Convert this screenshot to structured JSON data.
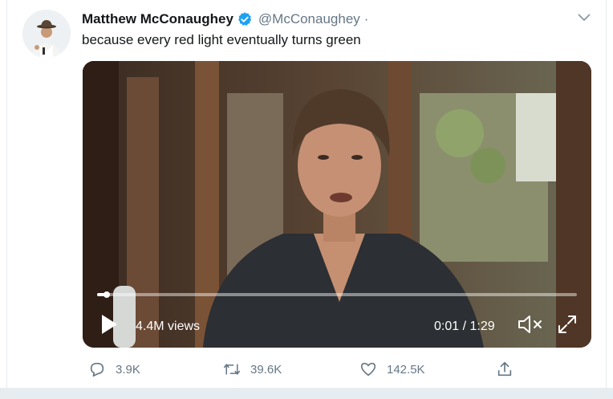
{
  "tweet": {
    "author": {
      "display_name": "Matthew McConaughey",
      "handle": "@McConaughey",
      "separator": "·",
      "verified": true
    },
    "text": "because every red light eventually turns green",
    "media": {
      "views": "4.4M views",
      "time": "0:01 / 1:29",
      "progress": 0.02
    },
    "actions": {
      "replies": "3.9K",
      "retweets": "39.6K",
      "likes": "142.5K"
    }
  },
  "colors": {
    "verified_badge": "#1da1f2",
    "secondary_text": "#657786",
    "page_background": "#e6ecf0"
  },
  "icons": [
    "verified-badge-icon",
    "chevron-down-icon",
    "play-icon",
    "mute-icon",
    "fullscreen-icon",
    "reply-icon",
    "retweet-icon",
    "like-icon",
    "share-icon"
  ]
}
